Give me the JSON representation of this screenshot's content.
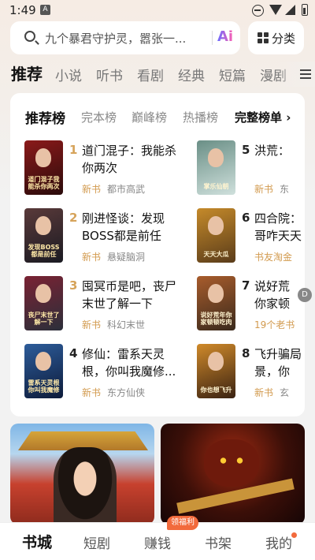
{
  "status_bar": {
    "time": "1:49",
    "notif_letter": "A"
  },
  "search": {
    "placeholder": "九个暴君守护灵，嚣张一...",
    "ai_label": "Ai"
  },
  "category_button": {
    "label": "分类"
  },
  "top_tabs": [
    "推荐",
    "小说",
    "听书",
    "看剧",
    "经典",
    "短篇",
    "漫剧"
  ],
  "ranking": {
    "tabs": [
      "推荐榜",
      "完本榜",
      "巅峰榜",
      "热播榜"
    ],
    "full_link": "完整榜单 ›",
    "left": [
      {
        "rank": "1",
        "title": "道门混子：我能杀你两次",
        "tag": "新书",
        "genre": "都市高武",
        "cover_text": "道门混子我能杀你两次",
        "cover_colors": [
          "#2a0b0b",
          "#8b1a1a"
        ]
      },
      {
        "rank": "2",
        "title": "刚进怪谈：发现BOSS都是前任",
        "tag": "新书",
        "genre": "悬疑脑洞",
        "cover_text": "发现BOSS都是前任",
        "cover_colors": [
          "#1a1a22",
          "#5a3a3a"
        ]
      },
      {
        "rank": "3",
        "title": "囤冥币是吧，丧尸末世了解一下",
        "tag": "新书",
        "genre": "科幻末世",
        "cover_text": "丧尸末世了解一下",
        "cover_colors": [
          "#2b2f3a",
          "#7a2233"
        ]
      },
      {
        "rank": "4",
        "title": "修仙：雷系天灵根，你叫我魔修...",
        "tag": "新书",
        "genre": "东方仙侠",
        "cover_text": "雷系天灵根你叫我魔修",
        "cover_colors": [
          "#0d1b3a",
          "#2d5c9a"
        ]
      }
    ],
    "right": [
      {
        "rank": "5",
        "title": "洪荒：",
        "title2": "",
        "tag": "新书",
        "genre": "东",
        "cover_text": "掌乐仙朝",
        "cover_colors": [
          "#cfe0dc",
          "#6a8f86"
        ]
      },
      {
        "rank": "6",
        "title": "四合院：",
        "title2": "哥咋天天",
        "tag": "书友淘金",
        "genre": "",
        "cover_text": "天天大瓜",
        "cover_colors": [
          "#5a3c1a",
          "#c58a2a"
        ]
      },
      {
        "rank": "7",
        "title": "说好荒",
        "title2": "你家顿",
        "tag": "19个老书",
        "genre": "",
        "cover_text": "说好荒年你家顿顿吃肉",
        "cover_colors": [
          "#3a2a1c",
          "#a85c2c"
        ]
      },
      {
        "rank": "8",
        "title": "飞升骗局",
        "title2": "景，你",
        "tag": "新书",
        "genre": "玄",
        "cover_text": "你也想飞升",
        "cover_colors": [
          "#3a2212",
          "#d08a2a"
        ]
      }
    ],
    "rank_colors": {
      "top": "#d6a35a",
      "normal": "#222222"
    }
  },
  "floating_badge": "D",
  "bottom_nav": {
    "items": [
      "书城",
      "短剧",
      "赚钱",
      "书架",
      "我的"
    ],
    "badge": "领福利"
  }
}
